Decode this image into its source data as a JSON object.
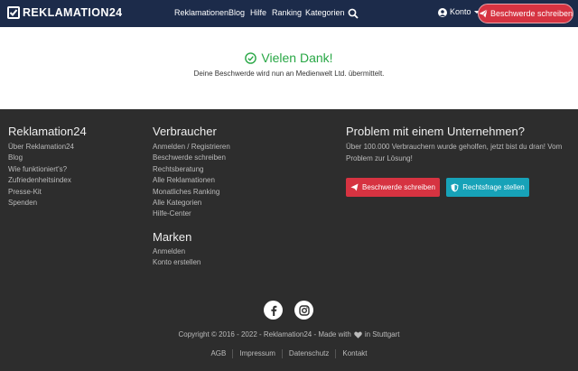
{
  "navbar": {
    "brand": "REKLAMATION24",
    "links": [
      "Reklamationen",
      "Blog",
      "Hilfe",
      "Ranking",
      "Kategorien"
    ],
    "account_label": "Konto",
    "cta_label": "Beschwerde schreiben"
  },
  "main": {
    "title": "Vielen Dank!",
    "subtitle": "Deine Beschwerde wird nun an Medienwelt Ltd. übermittelt."
  },
  "footer": {
    "col1": {
      "heading": "Reklamation24",
      "items": [
        "Über Reklamation24",
        "Blog",
        "Wie funktioniert's?",
        "Zufriedenheitsindex",
        "Presse-Kit",
        "Spenden"
      ]
    },
    "col2": {
      "heading": "Verbraucher",
      "items": [
        "Anmelden / Registrieren",
        "Beschwerde schreiben",
        "Rechtsberatung",
        "Alle Reklamationen",
        "Monatliches Ranking",
        "Alle Kategorien",
        "Hilfe-Center"
      ]
    },
    "col3": {
      "heading": "Marken",
      "items": [
        "Anmelden",
        "Konto erstellen"
      ]
    },
    "problem": {
      "heading": "Problem mit einem Unternehmen?",
      "text": "Über 100.000 Verbrauchern wurde geholfen, jetzt bist du dran! Vom Problem zur Lösung!",
      "btn_complaint": "Beschwerde schreiben",
      "btn_legal": "Rechtsfrage stellen"
    },
    "copyright_before": "Copyright © 2016 - 2022 - Reklamation24 - Made with",
    "copyright_after": "in Stuttgart",
    "links": [
      "AGB",
      "Impressum",
      "Datenschutz",
      "Kontakt"
    ]
  },
  "icons": {
    "search": "search-icon",
    "user": "user-circle-icon",
    "send": "paper-plane-icon",
    "check": "check-circle-icon",
    "shield": "shield-icon",
    "facebook": "facebook-icon",
    "instagram": "instagram-icon",
    "heart": "heart-icon"
  },
  "colors": {
    "navbar_bg": "#1c2b4a",
    "footer_bg": "#2d2d2d",
    "accent_red": "#d63341",
    "accent_teal": "#17a2b8",
    "success_green": "#28a745"
  }
}
